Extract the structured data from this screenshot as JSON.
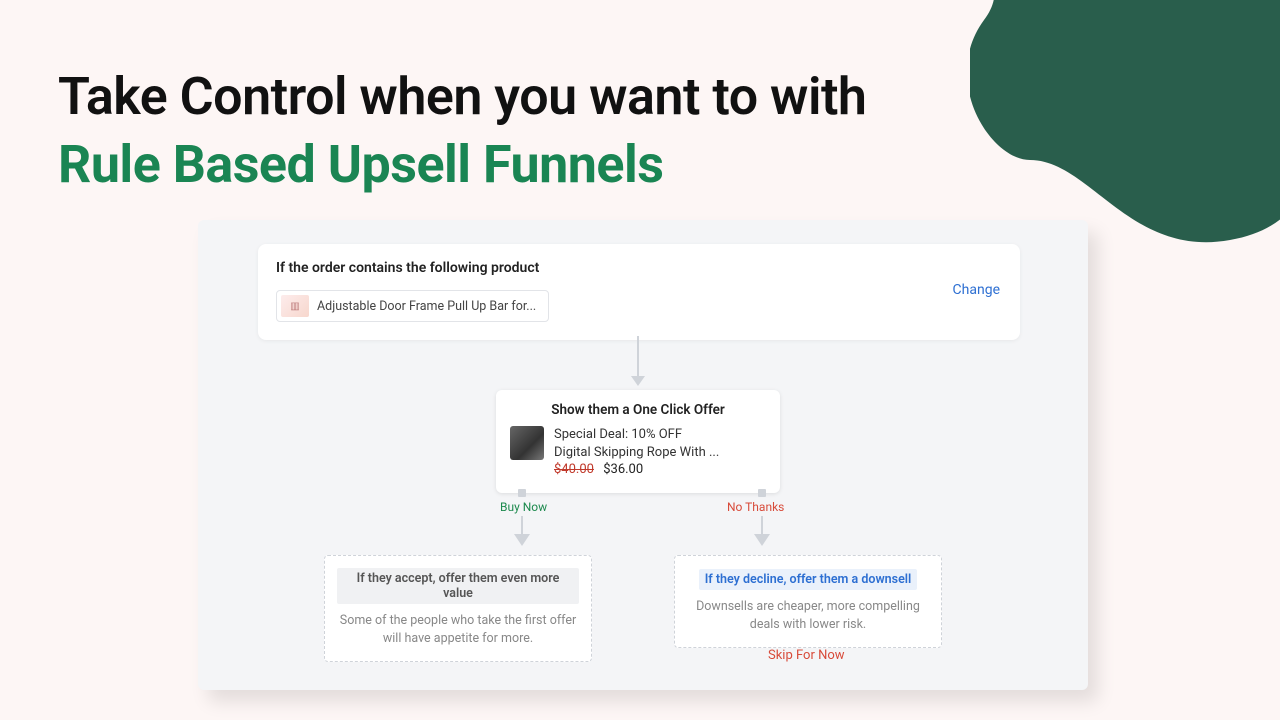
{
  "headline": {
    "line1": "Take Control when you want to with",
    "line2": "Rule Based Upsell Funnels"
  },
  "colors": {
    "accent_green": "#1a8553",
    "brand_dark_green": "#295e4c",
    "link_blue": "#2d6fd2",
    "danger_red": "#d84b3a"
  },
  "trigger": {
    "title": "If the order contains the following product",
    "product_name": "Adjustable Door Frame Pull Up Bar for...",
    "change_label": "Change"
  },
  "offer": {
    "title": "Show them a One Click Offer",
    "deal_line": "Special Deal: 10% OFF",
    "product_line": "Digital Skipping Rope With ...",
    "price_old": "$40.00",
    "price_new": "$36.00"
  },
  "branches": {
    "accept_label": "Buy Now",
    "decline_label": "No Thanks"
  },
  "accept_outcome": {
    "heading": "If they accept, offer them even more value",
    "desc": "Some of the people who take the first offer will have appetite for more."
  },
  "decline_outcome": {
    "heading": "If they decline, offer them a downsell",
    "desc": "Downsells are cheaper, more compelling deals with lower risk."
  },
  "skip_label": "Skip For Now"
}
